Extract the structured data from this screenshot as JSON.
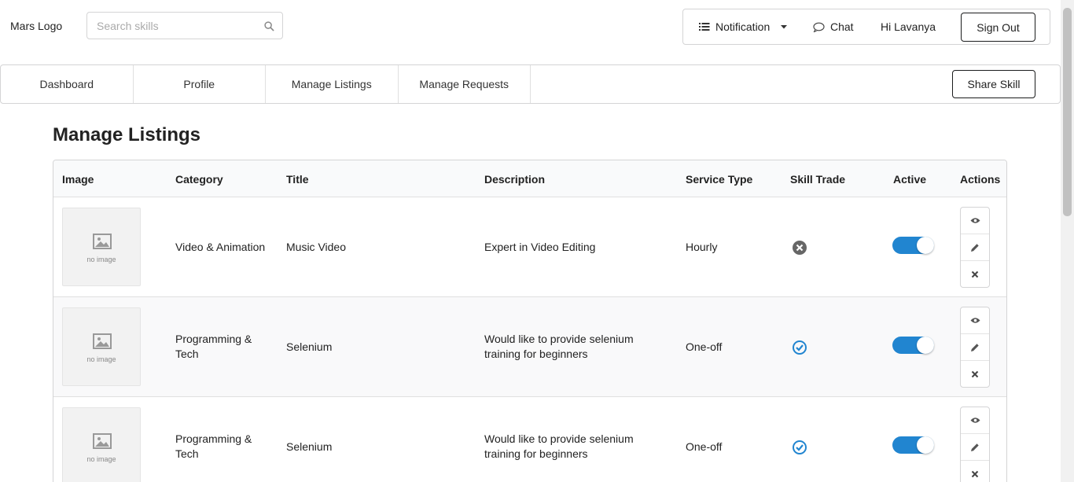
{
  "header": {
    "logo": "Mars Logo",
    "search_placeholder": "Search skills",
    "notification_label": "Notification",
    "chat_label": "Chat",
    "greeting": "Hi Lavanya",
    "signout_label": "Sign Out"
  },
  "nav": {
    "items": [
      "Dashboard",
      "Profile",
      "Manage Listings",
      "Manage Requests"
    ],
    "share_skill_label": "Share Skill"
  },
  "page_title": "Manage Listings",
  "table": {
    "columns": [
      "Image",
      "Category",
      "Title",
      "Description",
      "Service Type",
      "Skill Trade",
      "Active",
      "Actions"
    ],
    "no_image_text": "no image",
    "rows": [
      {
        "category": "Video & Animation",
        "title": "Music Video",
        "description": "Expert in Video Editing",
        "service_type": "Hourly",
        "skill_trade": "cross-circle-icon",
        "active": true
      },
      {
        "category": "Programming & Tech",
        "title": "Selenium",
        "description": "Would like to provide selenium training for beginners",
        "service_type": "One-off",
        "skill_trade": "check-circle-icon",
        "active": true
      },
      {
        "category": "Programming & Tech",
        "title": "Selenium",
        "description": "Would like to provide selenium training for beginners",
        "service_type": "One-off",
        "skill_trade": "check-circle-icon",
        "active": true
      }
    ]
  },
  "colors": {
    "accent": "#2185d0",
    "border": "#d4d4d5"
  }
}
